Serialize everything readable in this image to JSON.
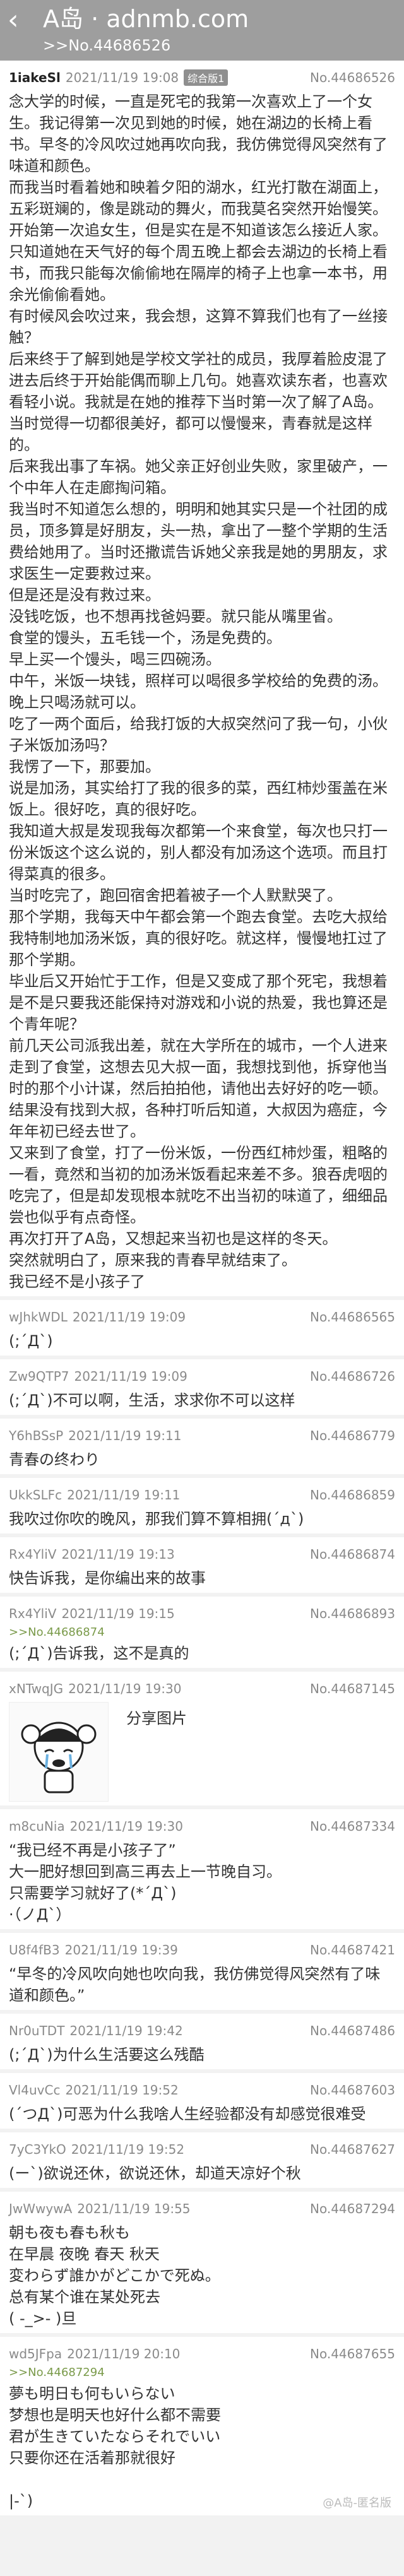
{
  "header": {
    "back_icon": "back-arrow-icon",
    "title": "A岛 · adnmb.com",
    "subtitle": ">>No.44686526"
  },
  "posts": [
    {
      "uid": "1iakeSl",
      "time": "2021/11/19 19:08",
      "badge": "综合版1",
      "no": "No.44686526",
      "content": "念大学的时候，一直是死宅的我第一次喜欢上了一个女生。我记得第一次见到她的时候，她在湖边的长椅上看书。早冬的冷风吹过她再吹向我，我仿佛觉得风突然有了味道和颜色。\n而我当时看着她和映着夕阳的湖水，红光打散在湖面上，五彩斑斓的，像是跳动的舞火，而我莫名突然开始慢笑。\n开始第一次追女生，但是实在是不知道该怎么接近人家。只知道她在天气好的每个周五晚上都会去湖边的长椅上看书，而我只能每次偷偷地在隔岸的椅子上也拿一本书，用余光偷偷看她。\n有时候风会吹过来，我会想，这算不算我们也有了一丝接触？\n后来终于了解到她是学校文学社的成员，我厚着脸皮混了进去后终于开始能偶而聊上几句。她喜欢读东者，也喜欢看轻小说。我就是在她的推荐下当时第一次了解了A岛。当时觉得一切都很美好，都可以慢慢来，青春就是这样的。\n后来我出事了车祸。她父亲正好创业失败，家里破产，一个中年人在走廊掏问箱。\n我当时不知道怎么想的，明明和她其实只是一个社团的成员，顶多算是好朋友，头一热，拿出了一整个学期的生活费给她用了。当时还撒谎告诉她父亲我是她的男朋友，求求医生一定要救过来。\n但是还是没有救过来。\n没钱吃饭，也不想再找爸妈要。就只能从嘴里省。\n食堂的馒头，五毛钱一个，汤是免费的。\n早上买一个馒头，喝三四碗汤。\n中午，米饭一块钱，照样可以喝很多学校给的免费的汤。晚上只喝汤就可以。\n吃了一两个面后，给我打饭的大叔突然问了我一句，小伙子米饭加汤吗？\n我愣了一下，那要加。\n说是加汤，其实给打了我的很多的菜，西红柿炒蛋盖在米饭上。很好吃，真的很好吃。\n我知道大叔是发现我每次都第一个来食堂，每次也只打一份米饭这个这么说的，别人都没有加汤这个选项。而且打得菜真的很多。\n当时吃完了，跑回宿舍把着被子一个人默默哭了。\n那个学期，我每天中午都会第一个跑去食堂。去吃大叔给我特制地加汤米饭，真的很好吃。就这样，慢慢地扛过了那个学期。\n毕业后又开始忙于工作，但是又变成了那个死宅，我想着是不是只要我还能保持对游戏和小说的热爱，我也算还是个青年呢？\n前几天公司派我出差，就在大学所在的城市，一个人进来走到了食堂，这想去见大叔一面，我想找到他，拆穿他当时的那个小计谋，然后拍拍他，请他出去好好的吃一顿。\n结果没有找到大叔，各种打听后知道，大叔因为癌症，今年年初已经去世了。\n又来到了食堂，打了一份米饭，一份西红柿炒蛋，粗略的一看，竟然和当初的加汤米饭看起来差不多。狼吞虎咽的吃完了，但是却发现根本就吃不出当初的味道了，细细品尝也似乎有点奇怪。\n再次打开了A岛，又想起来当初也是这样的冬天。\n突然就明白了，原来我的青春早就结束了。\n我已经不是小孩子了"
    },
    {
      "uid": "wJhkWDL",
      "time": "2021/11/19 19:09",
      "no": "No.44686565",
      "content": "(;´Д`)"
    },
    {
      "uid": "Zw9QTP7",
      "time": "2021/11/19 19:09",
      "no": "No.44686726",
      "content": "(;´Д`)不可以啊，生活，求求你不可以这样"
    },
    {
      "uid": "Y6hBSsP",
      "time": "2021/11/19 19:11",
      "no": "No.44686779",
      "content": "青春の终わり"
    },
    {
      "uid": "UkkSLFc",
      "time": "2021/11/19 19:11",
      "no": "No.44686859",
      "content": "我吹过你吹的晚风，那我们算不算相拥(´д`)"
    },
    {
      "uid": "Rx4YliV",
      "time": "2021/11/19 19:13",
      "no": "No.44686874",
      "content": "快告诉我，是你编出来的故事"
    },
    {
      "uid": "Rx4YliV",
      "time": "2021/11/19 19:15",
      "no": "No.44686893",
      "ref": ">>No.44686874",
      "content": "(;´Д`)告诉我，这不是真的"
    },
    {
      "uid": "xNTwqJG",
      "time": "2021/11/19 19:30",
      "no": "No.44687145",
      "share_label": "分享图片",
      "image_icon": "crying-girl-icon"
    },
    {
      "uid": "m8cuNia",
      "time": "2021/11/19 19:30",
      "no": "No.44687334",
      "content": "“我已经不再是小孩子了”\n大一肥好想回到高三再去上一节晚自习。\n只需要学习就好了(*´Д`)\n·（ノД`）"
    },
    {
      "uid": "U8f4fB3",
      "time": "2021/11/19 19:39",
      "no": "No.44687421",
      "content": "“早冬的冷风吹向她也吹向我，我仿佛觉得风突然有了味道和颜色。”"
    },
    {
      "uid": "Nr0uTDT",
      "time": "2021/11/19 19:42",
      "no": "No.44687486",
      "content": "(;´Д`)为什么生活要这么残酷"
    },
    {
      "uid": "Vl4uvCc",
      "time": "2021/11/19 19:52",
      "no": "No.44687603",
      "content": "(´つД`)可恶为什么我啥人生经验都没有却感觉很难受"
    },
    {
      "uid": "7yC3YkO",
      "time": "2021/11/19 19:52",
      "no": "No.44687627",
      "content": "(ー`)欲说还休，欲说还休，却道天凉好个秋"
    },
    {
      "uid": "JwWwywA",
      "time": "2021/11/19 19:55",
      "no": "No.44687294",
      "content": "朝も夜も春も秋も\n在早晨 夜晚 春天 秋天\n変わらず誰かがどこかで死ぬ。\n总有某个谁在某处死去\n( -_>- )旦"
    },
    {
      "uid": "wd5JFpa",
      "time": "2021/11/19 20:10",
      "no": "No.44687655",
      "ref": ">>No.44687294",
      "content": "夢も明日も何もいらない\n梦想也是明天也好什么都不需要\n君が生きていたならそれでいい\n只要你还在活着那就很好\n\n|-`)"
    }
  ],
  "watermark": "@A岛-匿名版"
}
